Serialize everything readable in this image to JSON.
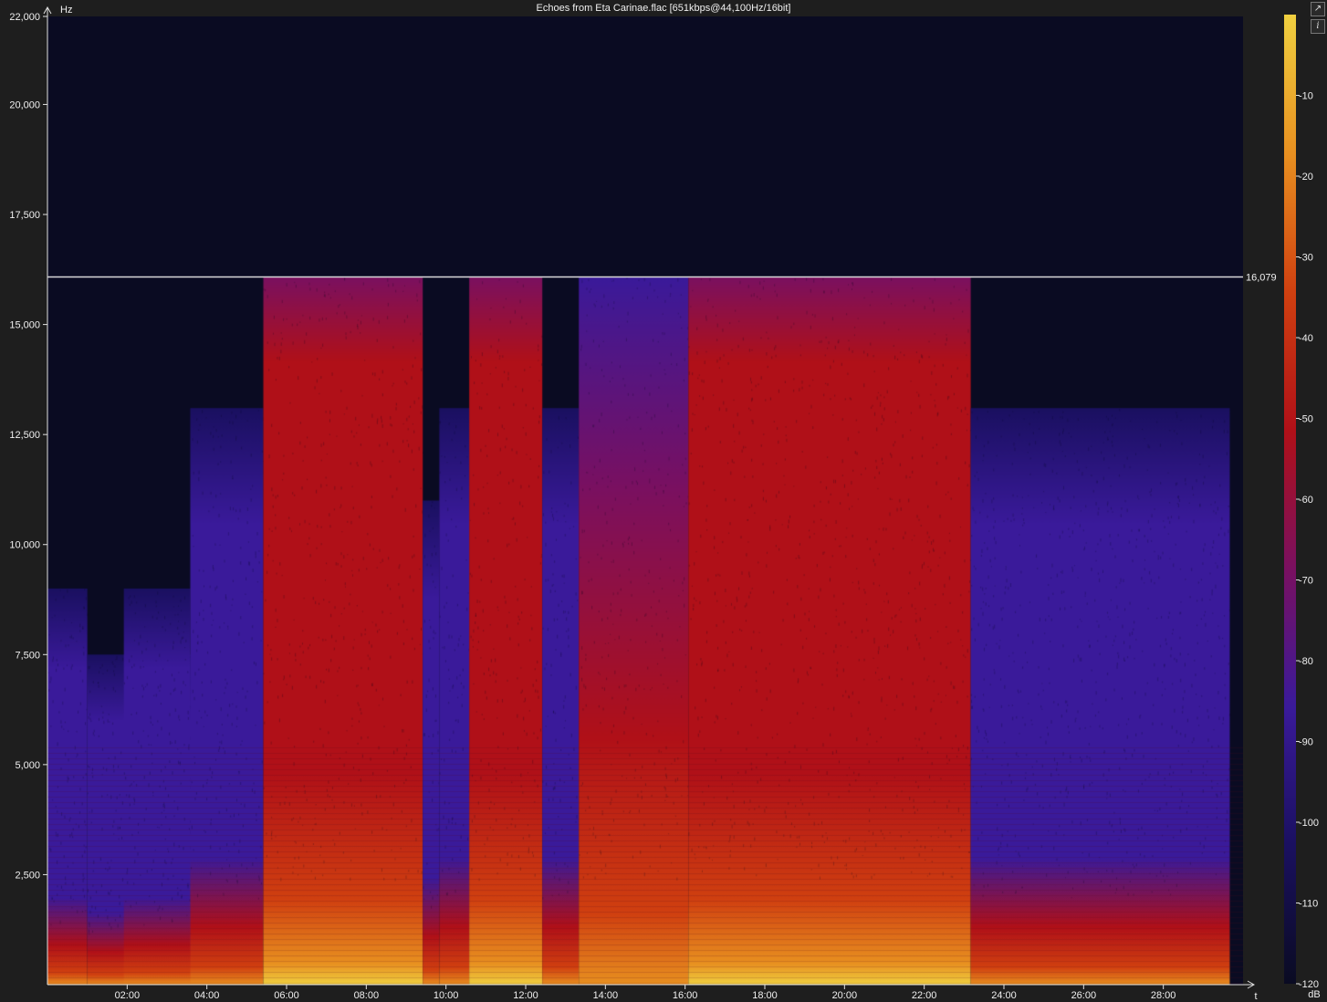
{
  "window": {
    "title": "Echoes from Eta Carinae.flac [651kbps@44,100Hz/16bit]"
  },
  "buttons": {
    "expand_icon": "↗",
    "info_icon": "i"
  },
  "chart_data": {
    "type": "heatmap",
    "title": "Echoes from Eta Carinae.flac [651kbps@44,100Hz/16bit]",
    "ylabel": "Hz",
    "xlabel": "t",
    "colorbar_label": "dB",
    "ylim": [
      0,
      22000
    ],
    "xlim_seconds": [
      0,
      1800
    ],
    "y_ticks": [
      {
        "value": 2500,
        "label": "2,500"
      },
      {
        "value": 5000,
        "label": "5,000"
      },
      {
        "value": 7500,
        "label": "7,500"
      },
      {
        "value": 10000,
        "label": "10,000"
      },
      {
        "value": 12500,
        "label": "12,500"
      },
      {
        "value": 15000,
        "label": "15,000"
      },
      {
        "value": 17500,
        "label": "17,500"
      },
      {
        "value": 20000,
        "label": "20,000"
      },
      {
        "value": 22000,
        "label": "22,000"
      }
    ],
    "x_ticks": [
      {
        "value": 120,
        "label": "02:00"
      },
      {
        "value": 240,
        "label": "04:00"
      },
      {
        "value": 360,
        "label": "06:00"
      },
      {
        "value": 480,
        "label": "08:00"
      },
      {
        "value": 600,
        "label": "10:00"
      },
      {
        "value": 720,
        "label": "12:00"
      },
      {
        "value": 840,
        "label": "14:00"
      },
      {
        "value": 960,
        "label": "16:00"
      },
      {
        "value": 1080,
        "label": "18:00"
      },
      {
        "value": 1200,
        "label": "20:00"
      },
      {
        "value": 1320,
        "label": "22:00"
      },
      {
        "value": 1440,
        "label": "24:00"
      },
      {
        "value": 1560,
        "label": "26:00"
      },
      {
        "value": 1680,
        "label": "28:00"
      }
    ],
    "cutoff": {
      "value": 16079,
      "label": "16,079"
    },
    "colorbar": {
      "range": [
        -120,
        0
      ],
      "ticks": [
        {
          "value": -10,
          "label": "-10"
        },
        {
          "value": -20,
          "label": "-20"
        },
        {
          "value": -30,
          "label": "-30"
        },
        {
          "value": -40,
          "label": "-40"
        },
        {
          "value": -50,
          "label": "-50"
        },
        {
          "value": -60,
          "label": "-60"
        },
        {
          "value": -70,
          "label": "-70"
        },
        {
          "value": -80,
          "label": "-80"
        },
        {
          "value": -90,
          "label": "-90"
        },
        {
          "value": -100,
          "label": "-100"
        },
        {
          "value": -110,
          "label": "-110"
        },
        {
          "value": -120,
          "label": "-120"
        }
      ],
      "colors": [
        "#0a0b22",
        "#1a1060",
        "#3a1a9a",
        "#7a1060",
        "#b01018",
        "#d04010",
        "#e89020",
        "#f0d040"
      ]
    },
    "background_color": "#0a0b22",
    "segments": [
      {
        "start": 0,
        "end": 60,
        "cutoff_hz": 9000,
        "level": "low"
      },
      {
        "start": 60,
        "end": 250,
        "cutoff_hz": 7500,
        "level": "low"
      },
      {
        "start": 115,
        "end": 215,
        "cutoff_hz": 9000,
        "level": "low"
      },
      {
        "start": 215,
        "end": 325,
        "cutoff_hz": 13100,
        "level": "low"
      },
      {
        "start": 325,
        "end": 565,
        "cutoff_hz": 16079,
        "level": "high"
      },
      {
        "start": 565,
        "end": 590,
        "cutoff_hz": 11000,
        "level": "low"
      },
      {
        "start": 590,
        "end": 635,
        "cutoff_hz": 13100,
        "level": "low"
      },
      {
        "start": 635,
        "end": 745,
        "cutoff_hz": 16079,
        "level": "high"
      },
      {
        "start": 745,
        "end": 800,
        "cutoff_hz": 13100,
        "level": "low"
      },
      {
        "start": 800,
        "end": 965,
        "cutoff_hz": 16079,
        "level": "mid"
      },
      {
        "start": 965,
        "end": 1390,
        "cutoff_hz": 16079,
        "level": "high"
      },
      {
        "start": 1390,
        "end": 1780,
        "cutoff_hz": 13100,
        "level": "low"
      }
    ]
  }
}
